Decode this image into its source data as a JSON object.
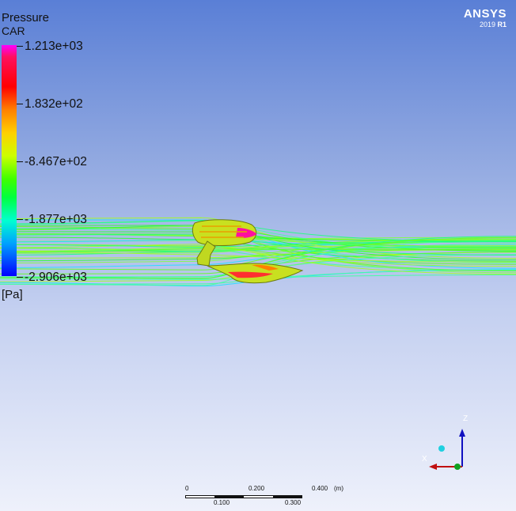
{
  "branding": {
    "product": "ANSYS",
    "version": "2019",
    "release": "R1"
  },
  "legend": {
    "variable": "Pressure",
    "location": "CAR",
    "ticks": [
      "1.213e+03",
      "1.832e+02",
      "-8.467e+02",
      "-1.877e+03",
      "-2.906e+03"
    ],
    "unit": "[Pa]"
  },
  "scale_bar": {
    "top_labels": [
      "0",
      "0.200",
      "0.400"
    ],
    "unit": "(m)",
    "bottom_labels": [
      "0.100",
      "0.300"
    ]
  },
  "axis_triad": {
    "z_label": "Z",
    "x_label": "X"
  }
}
